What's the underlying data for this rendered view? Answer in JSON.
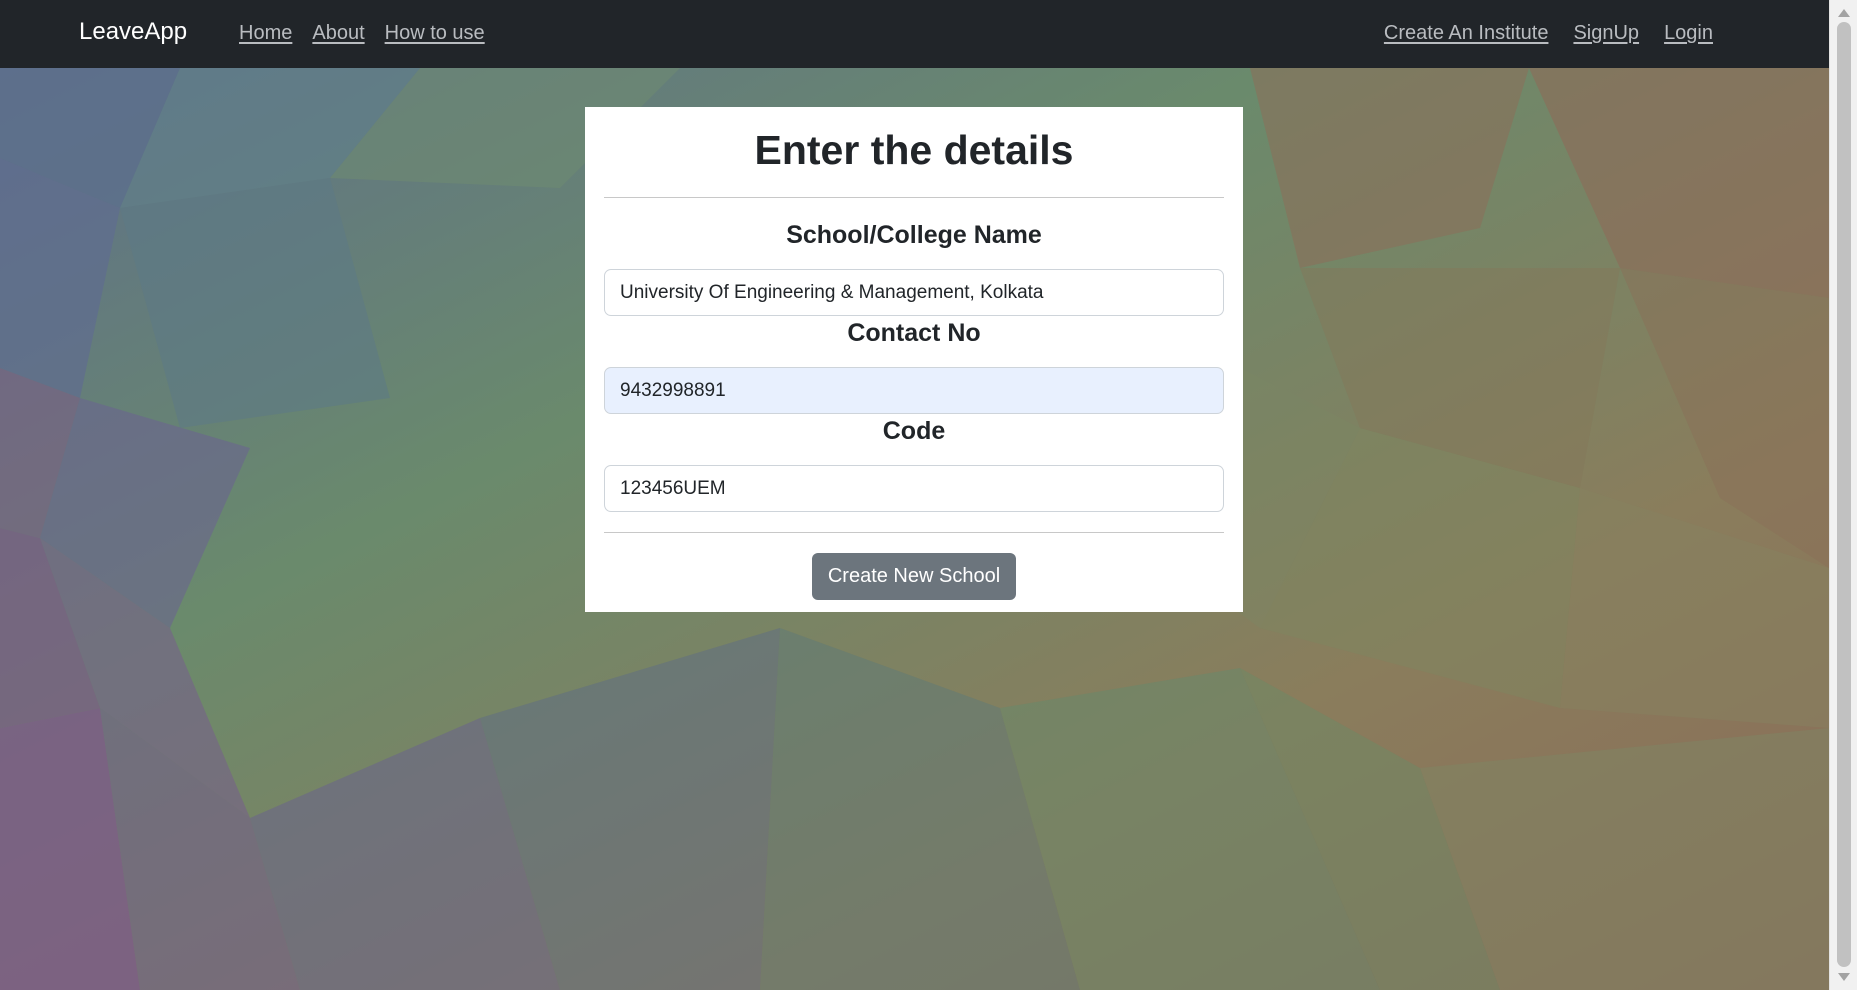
{
  "navbar": {
    "brand": "LeaveApp",
    "left_links": [
      "Home",
      "About",
      "How to use"
    ],
    "right_links": [
      "Create An Institute",
      "SignUp",
      "Login"
    ]
  },
  "form": {
    "title": "Enter the details",
    "fields": [
      {
        "label": "School/College Name",
        "value": "University Of Engineering & Management, Kolkata"
      },
      {
        "label": "Contact No",
        "value": "9432998891"
      },
      {
        "label": "Code",
        "value": "123456UEM"
      }
    ],
    "submit_label": "Create New School"
  },
  "colors": {
    "navbar_bg": "#212529",
    "button_bg": "#6c757d",
    "autofill_bg": "#e8f0fe"
  }
}
